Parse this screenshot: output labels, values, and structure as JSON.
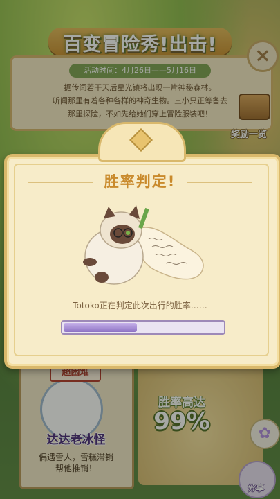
{
  "event": {
    "title": "百变冒险秀!出击!",
    "date": "活动时间：4月26日——5月16日",
    "story": [
      "据传闻若干天后星光镇将出现一片神秘森林。",
      "听闻那里有着各种各样的神奇生物。三小只正筹备去",
      "那里探险，不如先给她们穿上冒险服装吧！"
    ],
    "close_icon": "close-icon",
    "reward_label": "奖励一览"
  },
  "cards": {
    "monster_tag": "超困难",
    "monster_name": "达达老冰怪",
    "monster_desc": [
      "偶遇雪人，雪糕滞销",
      "帮他推销！"
    ],
    "win_label": "胜率高达",
    "win_value": "99%"
  },
  "side": {
    "share_label": "分享"
  },
  "dialog": {
    "title": "胜率判定!",
    "status": "Totoko正在判定此次出行的胜率……",
    "progress": 0.46
  },
  "colors": {
    "accent": "#c98a2c",
    "progress": "#8d72c3",
    "panel": "#f7ecc9"
  }
}
